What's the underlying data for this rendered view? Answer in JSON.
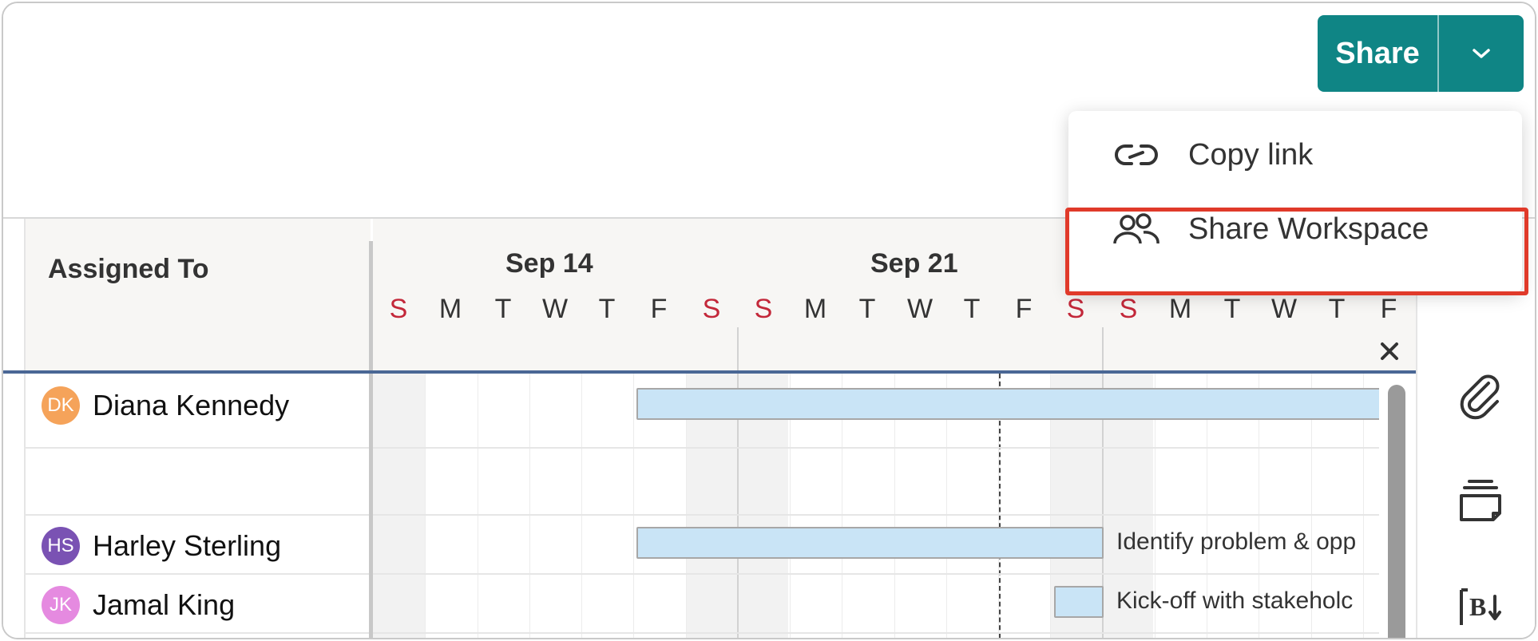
{
  "toolbar": {
    "share_label": "Share",
    "share_menu": {
      "items": [
        {
          "label": "Copy link",
          "icon": "link-icon"
        },
        {
          "label": "Share Workspace",
          "icon": "users-icon",
          "highlighted": true
        }
      ]
    }
  },
  "grid": {
    "assigned_header": "Assigned To",
    "weeks": [
      "Sep 14",
      "Sep 21"
    ],
    "days": [
      "S",
      "M",
      "T",
      "W",
      "T",
      "F",
      "S",
      "S",
      "M",
      "T",
      "W",
      "T",
      "F",
      "S",
      "S",
      "M",
      "T",
      "W",
      "T",
      "F"
    ],
    "close_label": "×"
  },
  "rows": [
    {
      "initials": "DK",
      "name": "Diana Kennedy",
      "avatar_color": "#f5a35a",
      "task": ""
    },
    {
      "initials": "",
      "name": "",
      "avatar_color": "",
      "task": ""
    },
    {
      "initials": "HS",
      "name": "Harley Sterling",
      "avatar_color": "#7a52b3",
      "task": "Identify problem & opp"
    },
    {
      "initials": "JK",
      "name": "Jamal King",
      "avatar_color": "#e58ae0",
      "task": "Kick-off with stakeholc"
    }
  ],
  "right_rail": {
    "icons": [
      "paperclip-icon",
      "cards-icon",
      "baseline-icon"
    ]
  },
  "colors": {
    "share_bg": "#0f8585",
    "weekend_text": "#c3283a",
    "task_bar": "#c9e4f6",
    "highlight": "#e03a2a",
    "header_line": "#4a6795"
  }
}
